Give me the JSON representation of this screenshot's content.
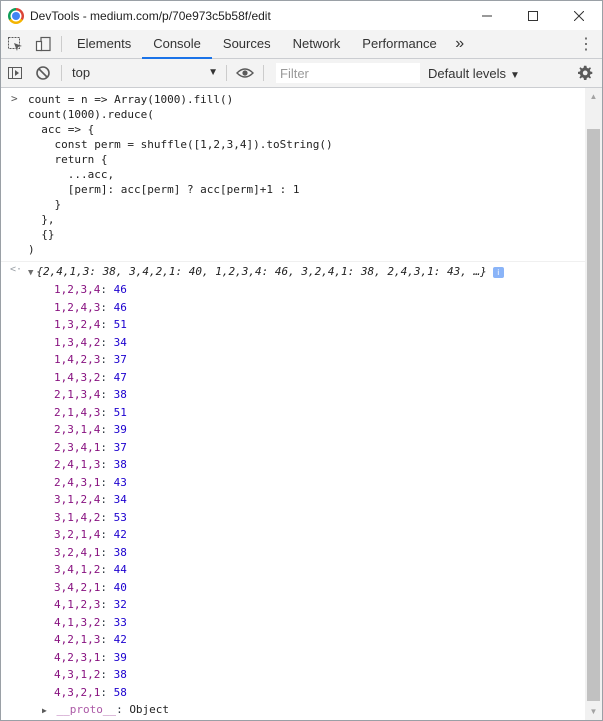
{
  "window": {
    "title": "DevTools - medium.com/p/70e973c5b58f/edit",
    "minimize": "─",
    "maximize": "☐",
    "close": "✕"
  },
  "tabs": {
    "items": [
      "Elements",
      "Console",
      "Sources",
      "Network",
      "Performance"
    ],
    "active": "Console",
    "more": "»",
    "menu": "⋮"
  },
  "console_toolbar": {
    "context": "top",
    "filter_placeholder": "Filter",
    "levels": "Default levels"
  },
  "input": {
    "lines": [
      "count = n => Array(1000).fill()",
      "count(1000).reduce(",
      "  acc => {",
      "    const perm = shuffle([1,2,3,4]).toString()",
      "    return {",
      "      ...acc,",
      "      [perm]: acc[perm] ? acc[perm]+1 : 1",
      "    }",
      "  },",
      "  {}",
      ")"
    ]
  },
  "output": {
    "summary": "{2,4,1,3: 38, 3,4,2,1: 40, 1,2,3,4: 46, 3,2,4,1: 38, 2,4,3,1: 43, …}",
    "properties": [
      {
        "key": "1,2,3,4",
        "value": "46"
      },
      {
        "key": "1,2,4,3",
        "value": "46"
      },
      {
        "key": "1,3,2,4",
        "value": "51"
      },
      {
        "key": "1,3,4,2",
        "value": "34"
      },
      {
        "key": "1,4,2,3",
        "value": "37"
      },
      {
        "key": "1,4,3,2",
        "value": "47"
      },
      {
        "key": "2,1,3,4",
        "value": "38"
      },
      {
        "key": "2,1,4,3",
        "value": "51"
      },
      {
        "key": "2,3,1,4",
        "value": "39"
      },
      {
        "key": "2,3,4,1",
        "value": "37"
      },
      {
        "key": "2,4,1,3",
        "value": "38"
      },
      {
        "key": "2,4,3,1",
        "value": "43"
      },
      {
        "key": "3,1,2,4",
        "value": "34"
      },
      {
        "key": "3,1,4,2",
        "value": "53"
      },
      {
        "key": "3,2,1,4",
        "value": "42"
      },
      {
        "key": "3,2,4,1",
        "value": "38"
      },
      {
        "key": "3,4,1,2",
        "value": "44"
      },
      {
        "key": "3,4,2,1",
        "value": "40"
      },
      {
        "key": "4,1,2,3",
        "value": "32"
      },
      {
        "key": "4,1,3,2",
        "value": "33"
      },
      {
        "key": "4,2,1,3",
        "value": "42"
      },
      {
        "key": "4,2,3,1",
        "value": "39"
      },
      {
        "key": "4,3,1,2",
        "value": "38"
      },
      {
        "key": "4,3,2,1",
        "value": "58"
      }
    ],
    "proto_key": "__proto__",
    "proto_value": "Object"
  },
  "colors": {
    "accent": "#1a73e8",
    "property_key": "#881280",
    "number": "#1c00cf"
  }
}
